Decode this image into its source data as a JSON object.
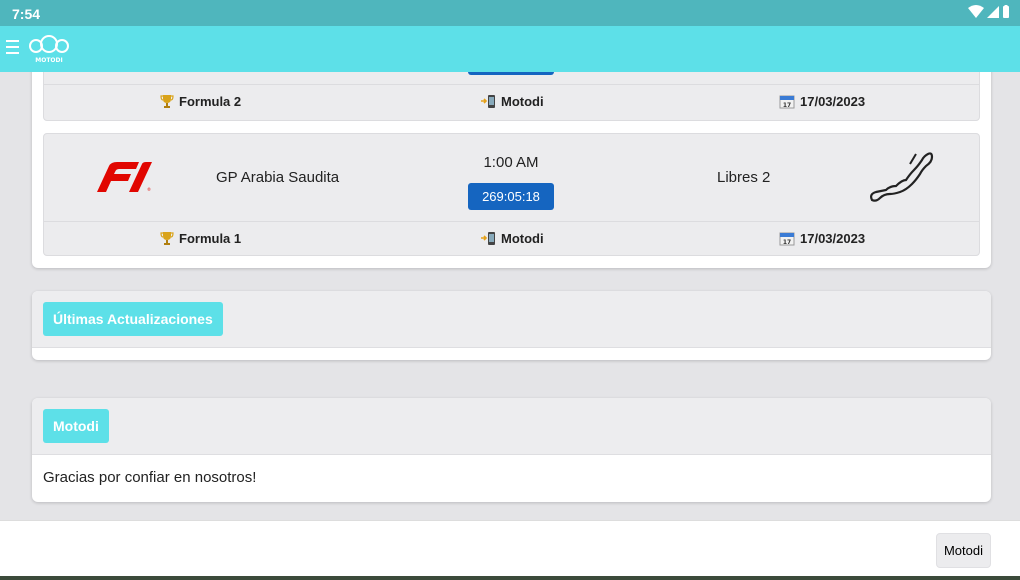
{
  "statusbar": {
    "time": "7:54"
  },
  "app": {
    "logo_text": "MOTODI"
  },
  "races": [
    {
      "time": "",
      "countdown": "",
      "category": "Formula 2",
      "source": "Motodi",
      "date": "17/03/2023"
    },
    {
      "event": "GP Arabia Saudita",
      "time": "1:00 AM",
      "countdown": "269:05:18",
      "session": "Libres 2",
      "category": "Formula 1",
      "source": "Motodi",
      "date": "17/03/2023"
    }
  ],
  "updates": {
    "title": "Últimas Actualizaciones"
  },
  "motodi": {
    "title": "Motodi",
    "message": "Gracias por confiar en nosotros!"
  },
  "footer": {
    "button": "Motodi"
  },
  "colors": {
    "accent": "#5de0e8",
    "statusbar": "#4fb6bd",
    "countdown": "#1565c0",
    "f1_red": "#e10600"
  },
  "icons": {
    "category": "trophy-icon",
    "source": "phone-icon",
    "date": "calendar-icon"
  }
}
